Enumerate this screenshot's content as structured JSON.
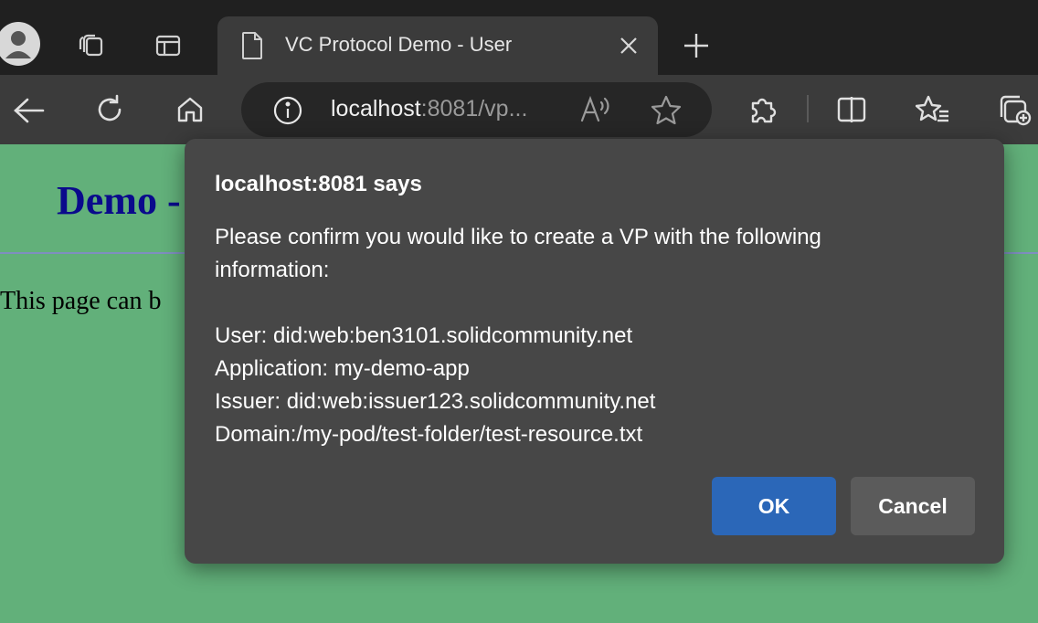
{
  "browser": {
    "tab": {
      "title": "VC Protocol Demo - User"
    },
    "address": {
      "host": "localhost",
      "rest": ":8081/vp..."
    },
    "icons": {
      "profile": "profile-avatar-icon",
      "workspaces": "workspaces-icon",
      "tab_actions": "tab-actions-icon",
      "page": "page-icon",
      "close_tab": "close-icon",
      "new_tab": "plus-icon",
      "back": "back-arrow-icon",
      "refresh": "refresh-icon",
      "home": "home-icon",
      "site_info": "info-icon",
      "read_aloud": "read-aloud-icon",
      "favorite": "star-icon",
      "extensions": "puzzle-icon",
      "split_screen": "split-screen-icon",
      "favorites": "favorites-icon",
      "collections": "collections-icon"
    }
  },
  "page": {
    "heading_visible": "Demo -",
    "text_visible": "This page can b"
  },
  "dialog": {
    "title": "localhost:8081 says",
    "message_lines": [
      "Please confirm you would like to create a VP with the following",
      "information:",
      "",
      "User: did:web:ben3101.solidcommunity.net",
      "Application: my-demo-app",
      "Issuer: did:web:issuer123.solidcommunity.net",
      "Domain:/my-pod/test-folder/test-resource.txt"
    ],
    "ok_label": "OK",
    "cancel_label": "Cancel"
  },
  "colors": {
    "page_bg": "#62b07a",
    "heading": "#0a0a8c",
    "dialog_bg": "#474747",
    "ok_button": "#2b67b8",
    "cancel_button": "#5b5b5b"
  }
}
